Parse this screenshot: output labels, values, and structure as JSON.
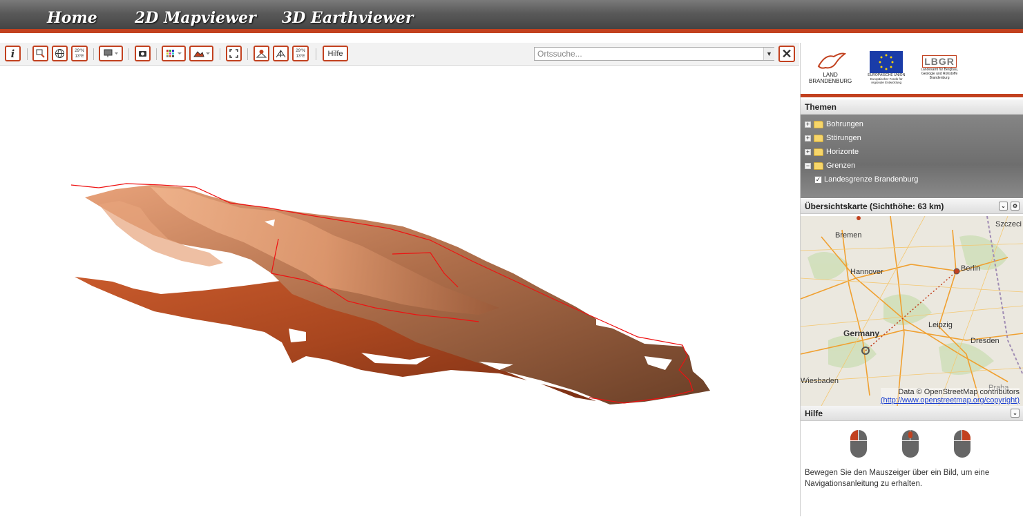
{
  "nav": {
    "tabs": [
      {
        "label": "Home",
        "active": false
      },
      {
        "label": "2D Mapviewer",
        "active": false
      },
      {
        "label": "3D Earthviewer",
        "active": true
      }
    ],
    "accent_color": "#c2411f"
  },
  "toolbar": {
    "coord_label_a": "29°N 13°E",
    "coord_label_b": "29°N 13°E",
    "hilfe_label": "Hilfe",
    "search_placeholder": "Ortssuche...",
    "close_label": "✕"
  },
  "logos": {
    "land_line1": "LAND",
    "land_line2": "BRANDENBURG",
    "eu_line1": "EUROPÄISCHE UNION",
    "eu_line2": "Europäischer Fonds für regionale Entwicklung",
    "lbgr_title": "LBGR",
    "lbgr_line1": "Landesamt für Bergbau,",
    "lbgr_line2": "Geologie und Rohstoffe",
    "lbgr_line3": "Brandenburg"
  },
  "themen": {
    "title": "Themen",
    "items": [
      {
        "label": "Bohrungen",
        "expanded": false
      },
      {
        "label": "Störungen",
        "expanded": false
      },
      {
        "label": "Horizonte",
        "expanded": false
      },
      {
        "label": "Grenzen",
        "expanded": true
      }
    ],
    "child": {
      "label": "Landesgrenze Brandenburg",
      "checked": true
    }
  },
  "overview": {
    "title": "Übersichtskarte (Sichthöhe: 63 km)",
    "cities": [
      "Bremen",
      "Hannover",
      "Berlin",
      "Leipzig",
      "Dresden",
      "Germany",
      "Wiesbaden",
      "Szczeci",
      "Praha"
    ],
    "attribution_text": "Data © OpenStreetMap contributors",
    "attribution_link": "(http://www.openstreetmap.org/copyright)"
  },
  "hilfe": {
    "title": "Hilfe",
    "text": "Bewegen Sie den Mauszeiger über ein Bild, um eine Navigationsanleitung zu erhalten."
  }
}
